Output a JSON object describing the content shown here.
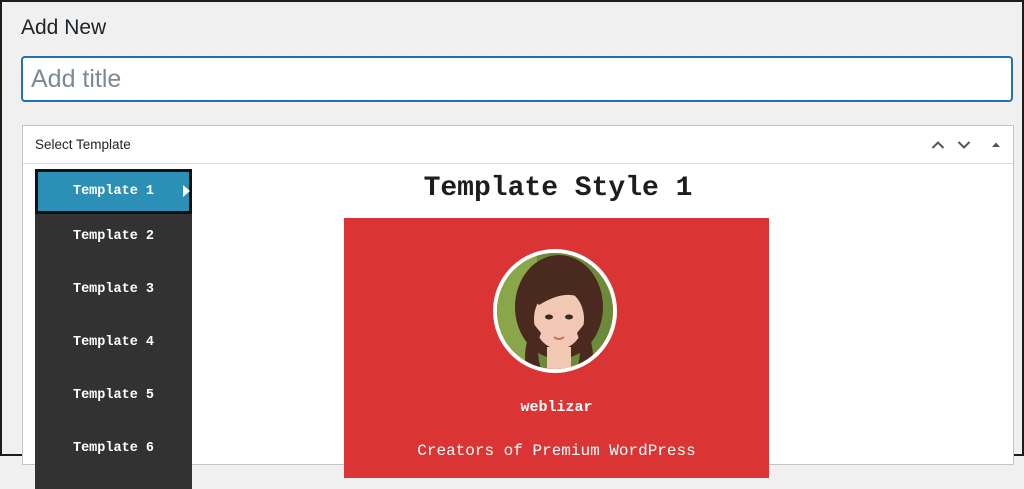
{
  "page": {
    "heading": "Add New"
  },
  "title_input": {
    "placeholder": "Add title",
    "value": ""
  },
  "metabox": {
    "title": "Select Template",
    "controls": [
      "chevron-up-icon",
      "chevron-down-icon",
      "triangle-up-icon"
    ]
  },
  "templates": {
    "items": [
      {
        "label": "Template 1",
        "active": true
      },
      {
        "label": "Template 2",
        "active": false
      },
      {
        "label": "Template 3",
        "active": false
      },
      {
        "label": "Template 4",
        "active": false
      },
      {
        "label": "Template 5",
        "active": false
      },
      {
        "label": "Template 6",
        "active": false
      }
    ]
  },
  "preview": {
    "heading": "Template Style 1",
    "card": {
      "background": "#db3434",
      "name": "weblizar",
      "tagline": "Creators of Premium WordPress"
    }
  },
  "colors": {
    "accent": "#2271b1",
    "nav_background": "#323232",
    "nav_active": "#2b8fb6"
  }
}
